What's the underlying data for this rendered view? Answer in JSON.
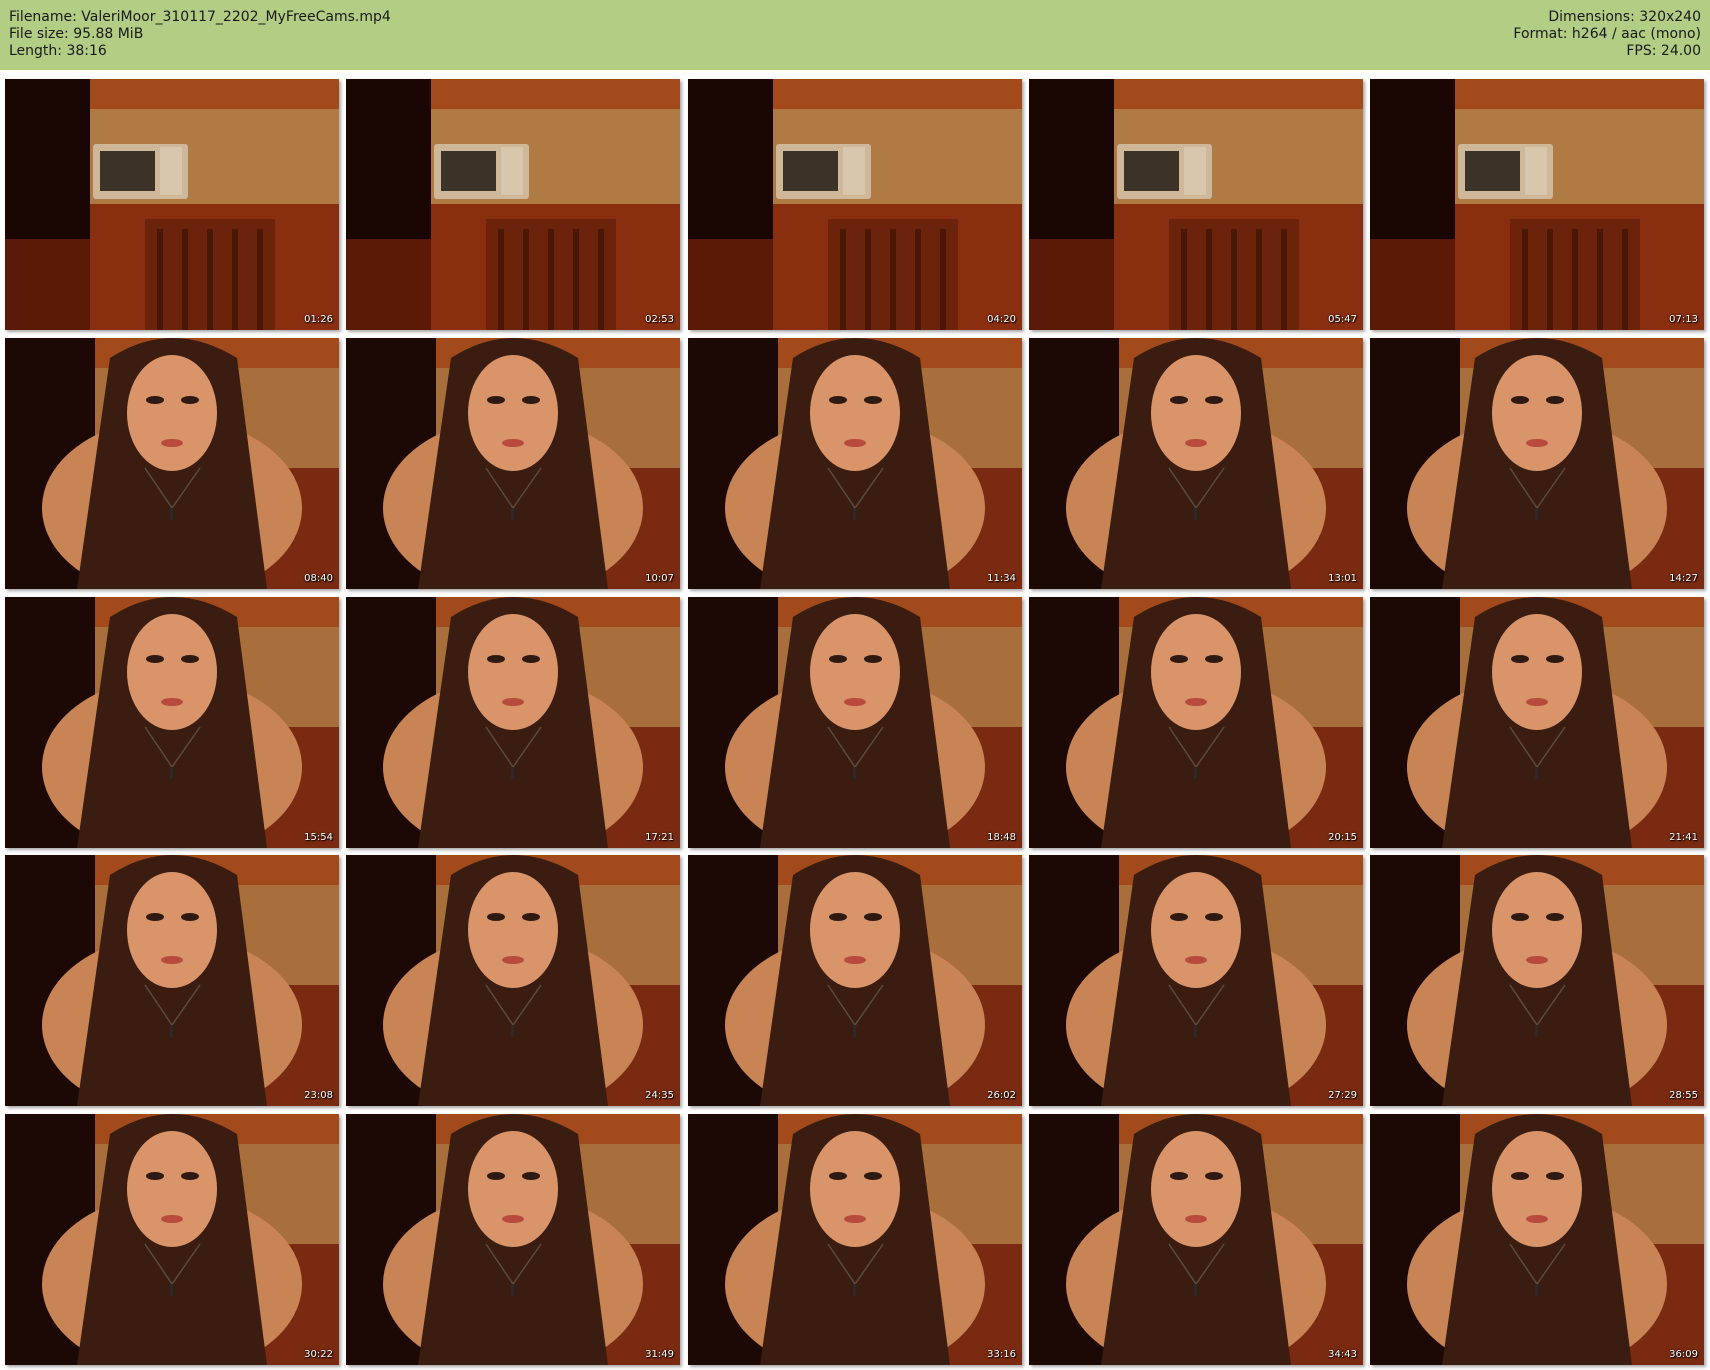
{
  "header": {
    "left": [
      "Filename: ValeriMoor_310117_2202_MyFreeCams.mp4",
      "File size: 95.88 MiB",
      "Length: 38:16"
    ],
    "right": [
      "Dimensions: 320x240",
      "Format: h264 / aac (mono)",
      "FPS: 24.00"
    ],
    "background": "#b2cd84"
  },
  "thumbnails": [
    {
      "time": "01:26",
      "scene": "empty-kitchen"
    },
    {
      "time": "02:53",
      "scene": "empty-kitchen"
    },
    {
      "time": "04:20",
      "scene": "empty-kitchen"
    },
    {
      "time": "05:47",
      "scene": "empty-kitchen"
    },
    {
      "time": "07:13",
      "scene": "empty-kitchen"
    },
    {
      "time": "08:40",
      "scene": "person"
    },
    {
      "time": "10:07",
      "scene": "person"
    },
    {
      "time": "11:34",
      "scene": "person"
    },
    {
      "time": "13:01",
      "scene": "person"
    },
    {
      "time": "14:27",
      "scene": "person"
    },
    {
      "time": "15:54",
      "scene": "person"
    },
    {
      "time": "17:21",
      "scene": "person"
    },
    {
      "time": "18:48",
      "scene": "person"
    },
    {
      "time": "20:15",
      "scene": "person"
    },
    {
      "time": "21:41",
      "scene": "person"
    },
    {
      "time": "23:08",
      "scene": "person"
    },
    {
      "time": "24:35",
      "scene": "person"
    },
    {
      "time": "26:02",
      "scene": "person"
    },
    {
      "time": "27:29",
      "scene": "person"
    },
    {
      "time": "28:55",
      "scene": "person"
    },
    {
      "time": "30:22",
      "scene": "person"
    },
    {
      "time": "31:49",
      "scene": "person"
    },
    {
      "time": "33:16",
      "scene": "person"
    },
    {
      "time": "34:43",
      "scene": "person"
    },
    {
      "time": "36:09",
      "scene": "person"
    }
  ]
}
